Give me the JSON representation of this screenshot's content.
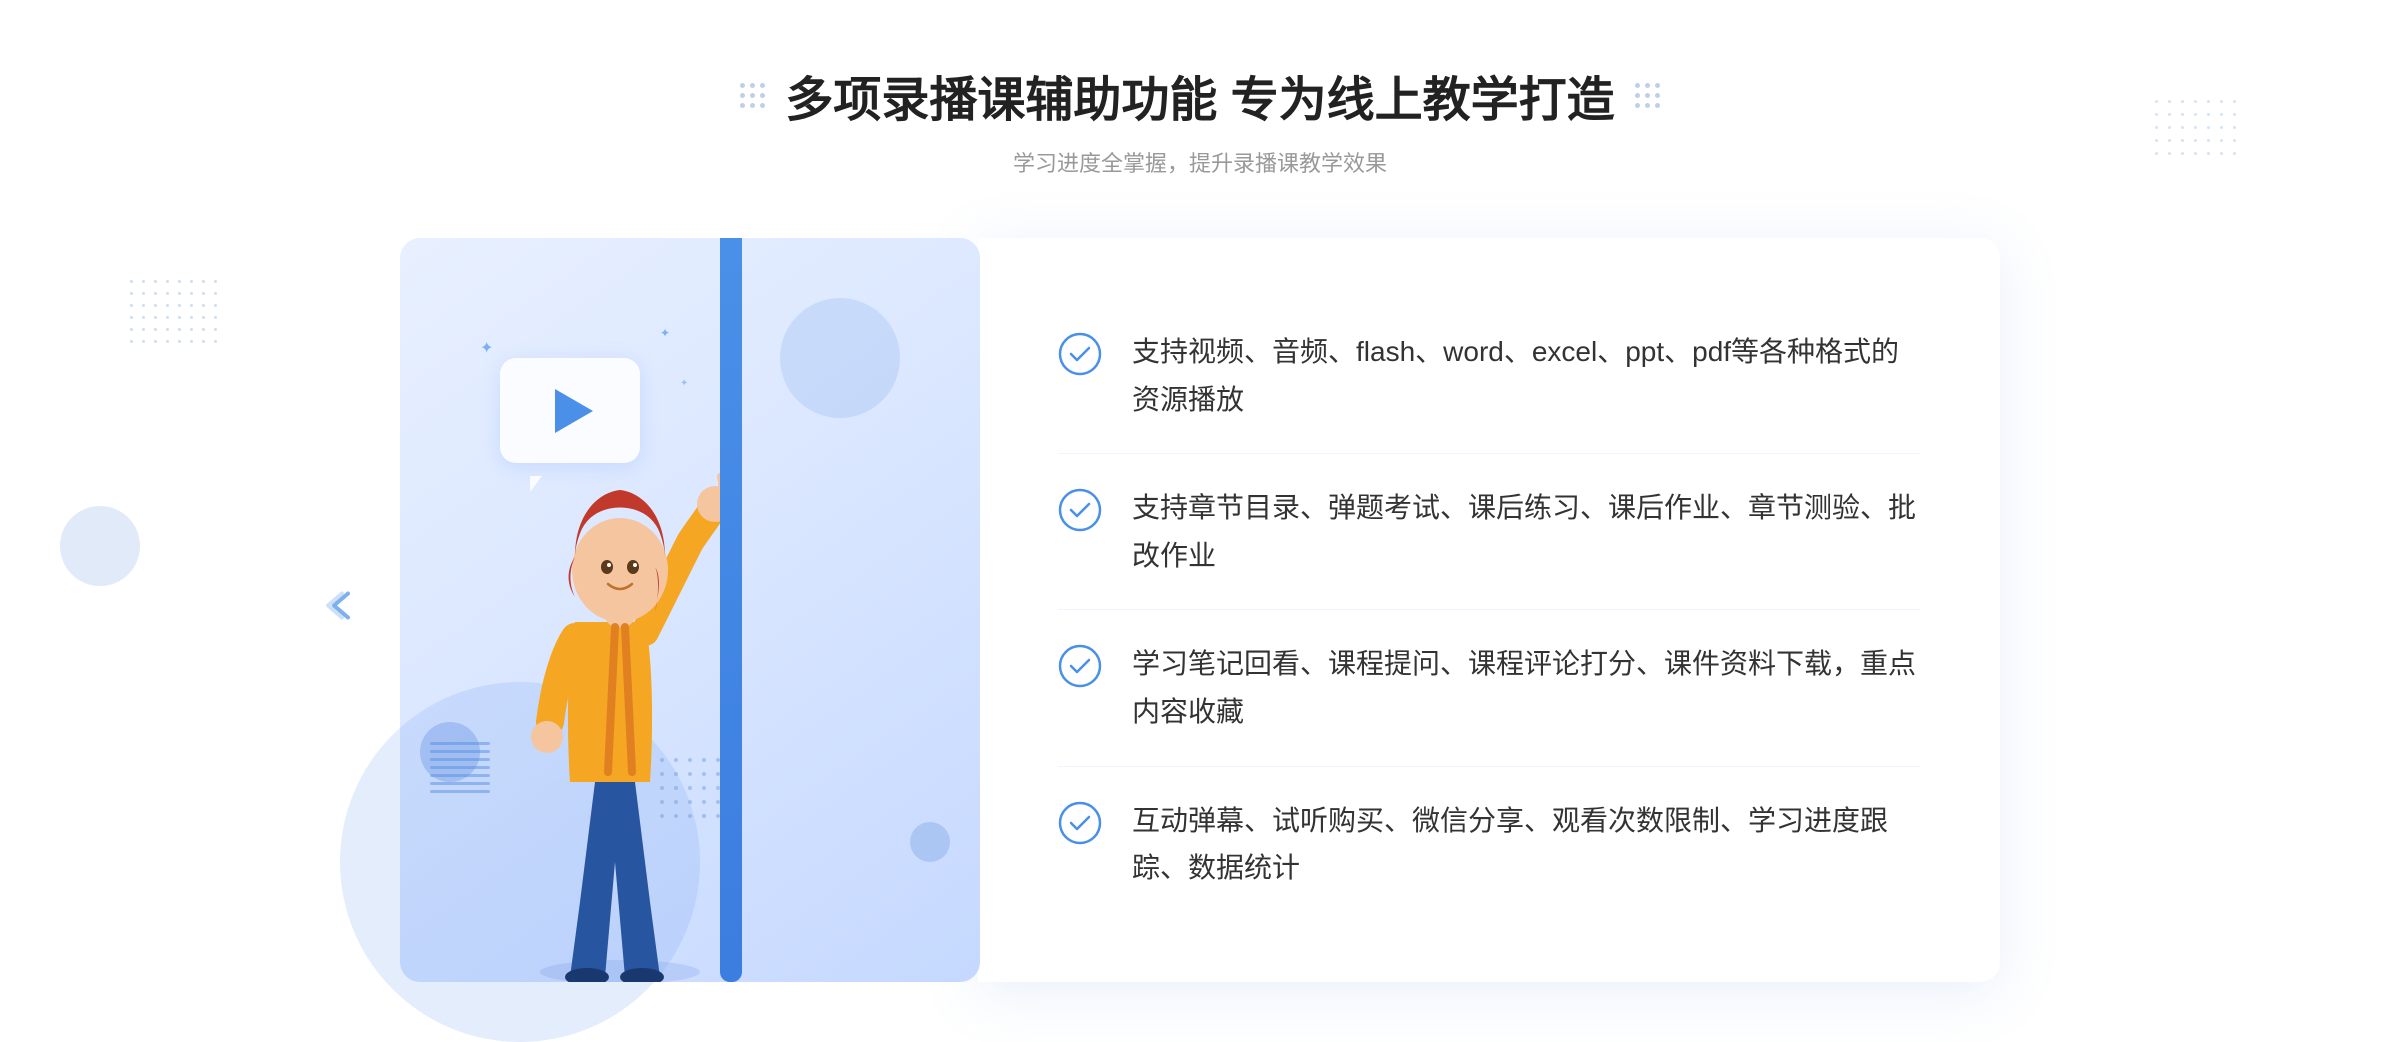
{
  "header": {
    "title": "多项录播课辅助功能 专为线上教学打造",
    "subtitle": "学习进度全掌握，提升录播课教学效果"
  },
  "features": [
    {
      "id": "feature-1",
      "text": "支持视频、音频、flash、word、excel、ppt、pdf等各种格式的资源播放"
    },
    {
      "id": "feature-2",
      "text": "支持章节目录、弹题考试、课后练习、课后作业、章节测验、批改作业"
    },
    {
      "id": "feature-3",
      "text": "学习笔记回看、课程提问、课程评论打分、课件资料下载，重点内容收藏"
    },
    {
      "id": "feature-4",
      "text": "互动弹幕、试听购买、微信分享、观看次数限制、学习进度跟踪、数据统计"
    }
  ],
  "icons": {
    "check": "check-circle-icon",
    "arrow_left": "chevron-left-icon"
  },
  "colors": {
    "primary": "#4a90e8",
    "text_dark": "#222222",
    "text_medium": "#333333",
    "text_light": "#999999",
    "bg_card": "#ffffff",
    "bg_illustration": "#dce8ff",
    "accent_blue": "#3b7de0"
  }
}
